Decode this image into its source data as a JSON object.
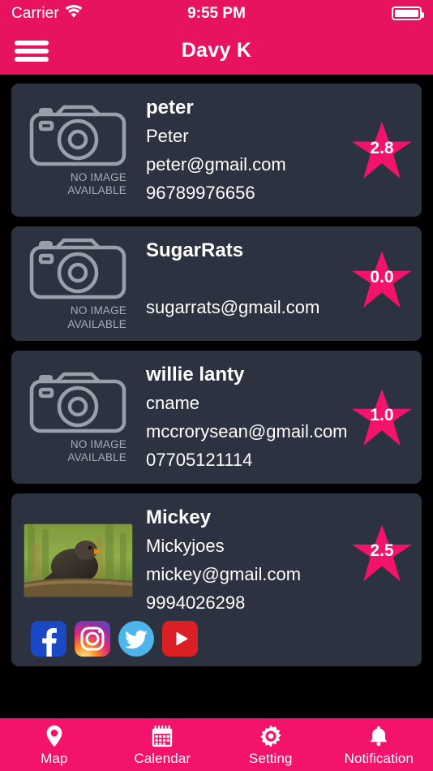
{
  "status_bar": {
    "carrier": "Carrier",
    "wifi_icon": "wifi-icon",
    "time": "9:55 PM",
    "battery_icon": "battery-full-icon"
  },
  "navbar": {
    "menu_icon": "hamburger-menu-icon",
    "title": "Davy K"
  },
  "colors": {
    "header_pink": "#E8135E",
    "accent_pink": "#F4136B",
    "card_bg": "#2D3240",
    "page_bg": "#000000",
    "text_primary": "#FFFFFF",
    "text_muted": "#A8ACB5"
  },
  "placeholder": {
    "icon": "camera-icon",
    "line1": "NO IMAGE",
    "line2": "AVAILABLE"
  },
  "cards": [
    {
      "name": "peter",
      "display_name": "Peter",
      "email": "peter@gmail.com",
      "phone": "96789976656",
      "rating": "2.8",
      "has_photo": false,
      "socials": []
    },
    {
      "name": "SugarRats",
      "display_name": "",
      "email": "sugarrats@gmail.com",
      "phone": "",
      "rating": "0.0",
      "has_photo": false,
      "socials": []
    },
    {
      "name": "willie lanty",
      "display_name": "cname",
      "email": "mccrorysean@gmail.com",
      "phone": "07705121114",
      "rating": "1.0",
      "has_photo": false,
      "socials": []
    },
    {
      "name": "Mickey",
      "display_name": "Mickyjoes",
      "email": "mickey@gmail.com",
      "phone": "9994026298",
      "rating": "2.5",
      "has_photo": true,
      "photo_alt": "blackbird perched on branch",
      "socials": [
        "facebook-icon",
        "instagram-icon",
        "twitter-icon",
        "youtube-icon"
      ]
    }
  ],
  "tabbar": {
    "items": [
      {
        "label": "Map",
        "icon": "map-pin-icon"
      },
      {
        "label": "Calendar",
        "icon": "calendar-icon"
      },
      {
        "label": "Setting",
        "icon": "gear-icon"
      },
      {
        "label": "Notification",
        "icon": "bell-icon"
      }
    ]
  }
}
